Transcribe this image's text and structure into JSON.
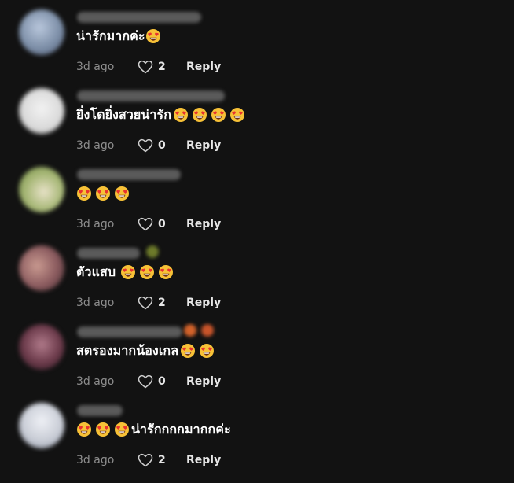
{
  "comments": [
    {
      "avatar_color": "#7d8fa8",
      "text": "น่ารักมากค่ะ",
      "emoji_before": [],
      "emoji_after": [
        "smiling-face-with-heart-eyes"
      ],
      "time": "3d ago",
      "likes": "2",
      "reply_label": "Reply"
    },
    {
      "avatar_color": "#d9d9d9",
      "text": "ยิ่งโตยิ่งสวยน่ารัก",
      "emoji_before": [],
      "emoji_after": [
        "smiling-face-with-heart-eyes",
        "smiling-face-with-heart-eyes",
        "smiling-face-with-heart-eyes",
        "smiling-face-with-heart-eyes"
      ],
      "time": "3d ago",
      "likes": "0",
      "reply_label": "Reply"
    },
    {
      "avatar_color": "#a8b878",
      "text": "",
      "emoji_before": [],
      "emoji_after": [
        "smiling-face-with-heart-eyes",
        "smiling-face-with-heart-eyes",
        "smiling-face-with-heart-eyes"
      ],
      "time": "3d ago",
      "likes": "0",
      "reply_label": "Reply"
    },
    {
      "avatar_color": "#8a5a5e",
      "text": "ตัวแสบ",
      "emoji_before": [],
      "emoji_after": [
        "smiling-face-with-heart-eyes",
        "smiling-face-with-heart-eyes",
        "smiling-face-with-heart-eyes"
      ],
      "time": "3d ago",
      "likes": "2",
      "reply_label": "Reply"
    },
    {
      "avatar_color": "#6b3a4a",
      "text": "สตรองมากน้องเกล",
      "emoji_before": [],
      "emoji_after": [
        "smiling-face-with-heart-eyes",
        "smiling-face-with-heart-eyes"
      ],
      "time": "3d ago",
      "likes": "0",
      "reply_label": "Reply"
    },
    {
      "avatar_color": "#c9cdd6",
      "text": "น่ารักกกกมากกค่ะ",
      "emoji_before": [
        "smiling-face-with-heart-eyes",
        "smiling-face-with-heart-eyes",
        "smiling-face-with-heart-eyes"
      ],
      "emoji_after": [],
      "time": "3d ago",
      "likes": "2",
      "reply_label": "Reply"
    }
  ],
  "colors": {
    "background": "#121212",
    "secondary_text": "#8e8e8e",
    "primary_text": "#ffffff"
  }
}
